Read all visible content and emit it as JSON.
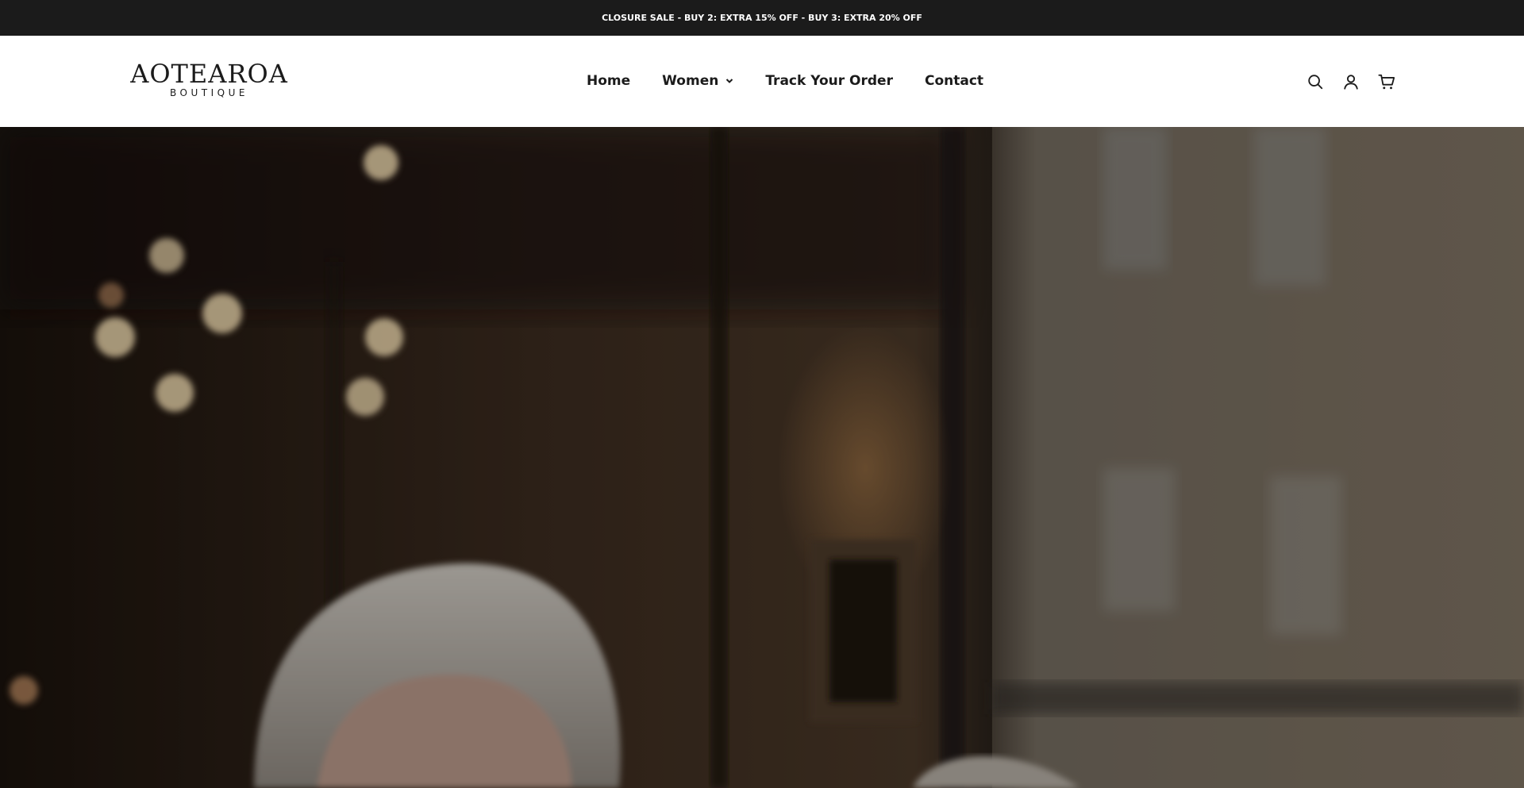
{
  "announcement": {
    "text": "CLOSURE SALE - BUY 2: EXTRA 15% OFF - BUY 3: EXTRA 20% OFF"
  },
  "logo": {
    "main": "AOTEAROA",
    "sub": "BOUTIQUE"
  },
  "nav": {
    "items": [
      {
        "label": "Home"
      },
      {
        "label": "Women",
        "has_dropdown": true
      },
      {
        "label": "Track Your Order"
      },
      {
        "label": "Contact"
      }
    ]
  },
  "header_icons": [
    "search-icon",
    "account-icon",
    "cart-icon"
  ],
  "colors": {
    "announcement_bg": "#1b1b1b",
    "text": "#1b1b1b"
  }
}
